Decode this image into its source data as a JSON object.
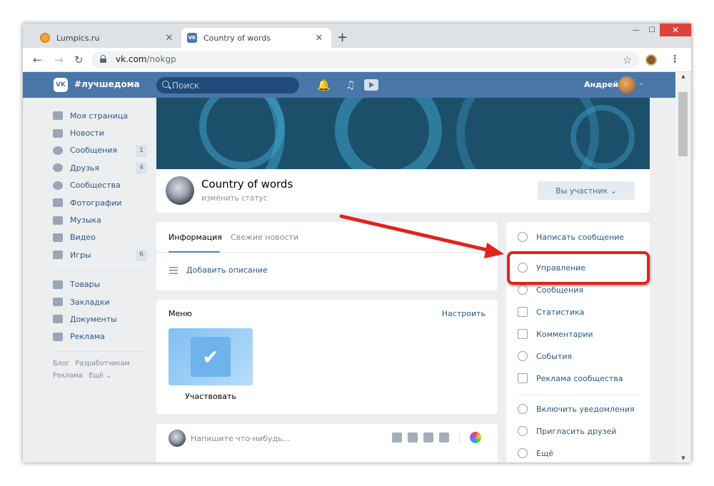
{
  "browser": {
    "tabs": [
      {
        "title": "Lumpics.ru",
        "close": "✕"
      },
      {
        "title": "Country of words",
        "close": "✕"
      }
    ],
    "new_tab": "+",
    "window_buttons": {
      "minimize": "—",
      "maximize": "☐",
      "close": "✕"
    },
    "url_host": "vk.com",
    "url_path": "/nokgp"
  },
  "vk_header": {
    "logo": "VK",
    "hashtag": "#лучшедома",
    "search_placeholder": "Поиск",
    "user_name": "Андрей"
  },
  "sidebar": {
    "items": [
      {
        "label": "Моя страница",
        "badge": ""
      },
      {
        "label": "Новости",
        "badge": ""
      },
      {
        "label": "Сообщения",
        "badge": "1"
      },
      {
        "label": "Друзья",
        "badge": "4"
      },
      {
        "label": "Сообщества",
        "badge": ""
      },
      {
        "label": "Фотографии",
        "badge": ""
      },
      {
        "label": "Музыка",
        "badge": ""
      },
      {
        "label": "Видео",
        "badge": ""
      },
      {
        "label": "Игры",
        "badge": "6"
      }
    ],
    "items2": [
      {
        "label": "Товары"
      },
      {
        "label": "Закладки"
      },
      {
        "label": "Документы"
      },
      {
        "label": "Реклама"
      }
    ],
    "footer": [
      "Блог",
      "Разработчикам",
      "Реклама",
      "Ещё ⌄"
    ]
  },
  "group": {
    "name": "Country of words",
    "status": "изменить статус",
    "member_button": "Вы участник ⌄"
  },
  "info": {
    "tab_info": "Информация",
    "tab_news": "Свежие новости",
    "add_description": "Добавить описание"
  },
  "menu": {
    "title": "Меню",
    "configure": "Настроить",
    "tile_label": "Участвовать"
  },
  "post": {
    "placeholder": "Напишите что-нибудь..."
  },
  "actions": {
    "items": [
      {
        "label": "Написать сообщение",
        "icon": "chat-bubble-icon"
      },
      {
        "label": "Управление",
        "icon": "gear-icon"
      },
      {
        "label": "Сообщения",
        "icon": "chat-bubble-icon"
      },
      {
        "label": "Статистика",
        "icon": "bar-chart-icon"
      },
      {
        "label": "Комментарии",
        "icon": "comment-icon"
      },
      {
        "label": "События",
        "icon": "events-icon"
      },
      {
        "label": "Реклама сообщества",
        "icon": "megaphone-icon"
      },
      {
        "label": "Включить уведомления",
        "icon": "bell-icon"
      },
      {
        "label": "Пригласить друзей",
        "icon": "add-user-icon"
      },
      {
        "label": "Ещё",
        "icon": "more-icon"
      }
    ]
  },
  "colors": {
    "vk_blue": "#4a76a8",
    "link": "#2a5885",
    "annotation_red": "#e3221c"
  }
}
